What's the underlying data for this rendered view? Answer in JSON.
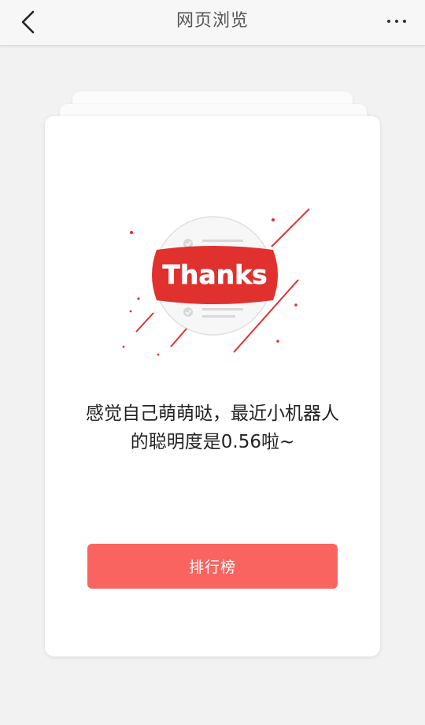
{
  "header": {
    "title": "网页浏览"
  },
  "card": {
    "badge_text": "Thanks",
    "message_line1": "感觉自己萌萌哒，最近小机器人",
    "message_line2": "的聪明度是0.56啦~",
    "button_label": "排行榜"
  },
  "colors": {
    "accent": "#fa6460",
    "badge_red": "#e0312e",
    "background": "#f2f2f2"
  },
  "icons": {
    "back": "chevron-left-icon",
    "more": "more-dots-icon"
  }
}
